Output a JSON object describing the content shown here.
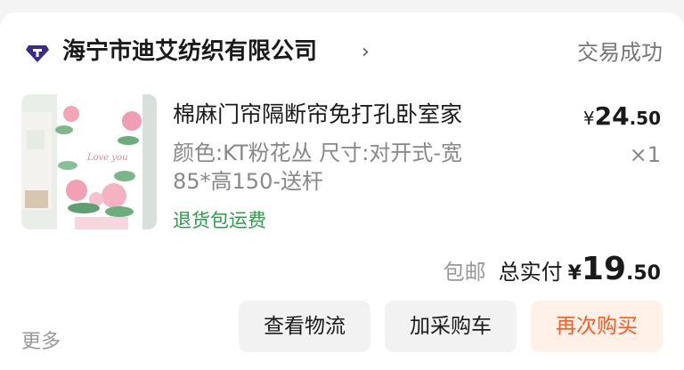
{
  "shop": {
    "name": "海宁市迪艾纺织有限公司",
    "icon": "diamond-shop-badge-icon",
    "chevron": "›"
  },
  "order": {
    "status": "交易成功"
  },
  "item": {
    "title": "棉麻门帘隔断帘免打孔卧室家",
    "spec_line1": "颜色:KT粉花丛 尺寸:对开式-宽",
    "spec_line2": "85*高150-送杆",
    "return_tag": "退货包运费",
    "price_symbol": "¥",
    "price_int": "24",
    "price_dec": ".50",
    "quantity": "×1",
    "image_text": "Love you"
  },
  "summary": {
    "shipping": "包邮",
    "total_label": "总实付",
    "price_symbol": "¥",
    "price_int": "19",
    "price_dec": ".50"
  },
  "actions": {
    "more": "更多",
    "logistics": "查看物流",
    "add_cart": "加采购车",
    "rebuy": "再次购买"
  },
  "colors": {
    "brand_icon": "#3a2b8c",
    "return_tag": "#2a9d4b",
    "rebuy_text": "#ff5a1f",
    "rebuy_bg": "#fff1e8"
  }
}
